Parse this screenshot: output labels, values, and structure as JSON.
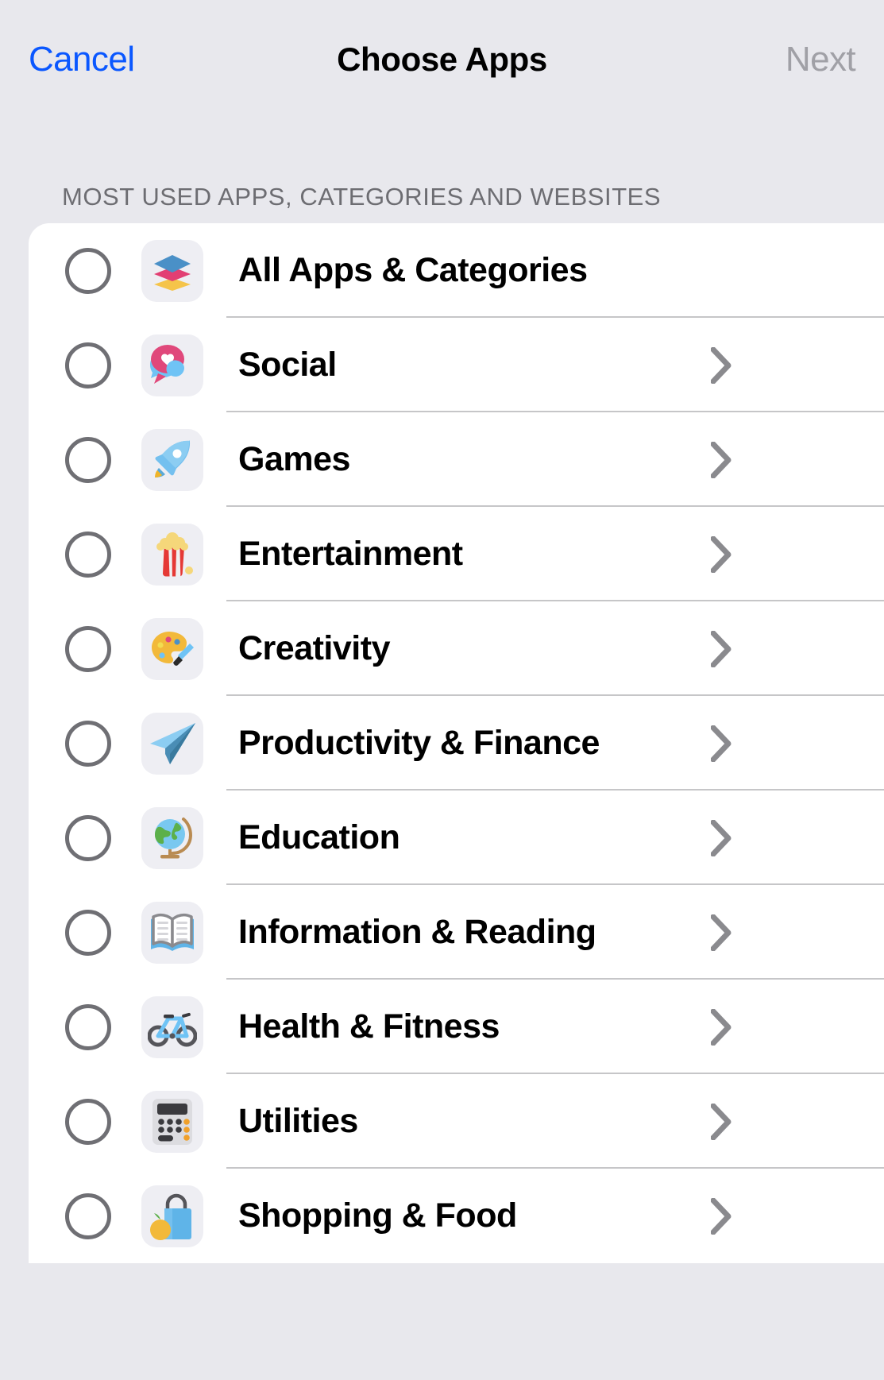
{
  "navbar": {
    "cancel_label": "Cancel",
    "title": "Choose Apps",
    "next_label": "Next"
  },
  "section": {
    "header": "MOST USED APPS, CATEGORIES AND WEBSITES"
  },
  "colors": {
    "background": "#e8e8ed",
    "card": "#ffffff",
    "cancel_blue": "#0a57ff",
    "next_gray": "#a0a0a6",
    "section_header_gray": "#6d6d72",
    "separator": "#c6c6c8",
    "radio_stroke": "#6f6f74",
    "chevron_gray": "#8a8a8e",
    "icon_tile": "#eeeef3"
  },
  "rows": [
    {
      "label": "All Apps & Categories",
      "icon": "layers-stack-icon",
      "has_chevron": false,
      "selected": false
    },
    {
      "label": "Social",
      "icon": "speech-bubble-heart-icon",
      "has_chevron": true,
      "selected": false
    },
    {
      "label": "Games",
      "icon": "rocket-icon",
      "has_chevron": true,
      "selected": false
    },
    {
      "label": "Entertainment",
      "icon": "popcorn-icon",
      "has_chevron": true,
      "selected": false
    },
    {
      "label": "Creativity",
      "icon": "palette-brush-icon",
      "has_chevron": true,
      "selected": false
    },
    {
      "label": "Productivity & Finance",
      "icon": "paper-plane-icon",
      "has_chevron": true,
      "selected": false
    },
    {
      "label": "Education",
      "icon": "globe-stand-icon",
      "has_chevron": true,
      "selected": false
    },
    {
      "label": "Information & Reading",
      "icon": "open-book-icon",
      "has_chevron": true,
      "selected": false
    },
    {
      "label": "Health & Fitness",
      "icon": "bicycle-icon",
      "has_chevron": true,
      "selected": false
    },
    {
      "label": "Utilities",
      "icon": "calculator-icon",
      "has_chevron": true,
      "selected": false
    },
    {
      "label": "Shopping & Food",
      "icon": "shopping-bag-icon",
      "has_chevron": true,
      "selected": false
    }
  ]
}
